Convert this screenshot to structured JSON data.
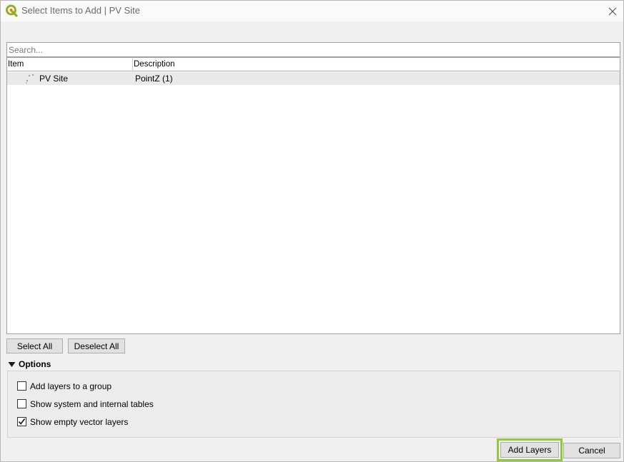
{
  "window": {
    "title": "Select Items to Add | PV Site",
    "app_icon": "qgis-logo-icon",
    "close_icon": "close-icon"
  },
  "search": {
    "placeholder": "Search...",
    "value": ""
  },
  "tree": {
    "columns": [
      "Item",
      "Description"
    ],
    "rows": [
      {
        "item": "PV Site",
        "description": "PointZ (1)",
        "icon": "point-layer-icon",
        "selected": true
      }
    ]
  },
  "selection_buttons": {
    "select_all": "Select All",
    "deselect_all": "Deselect All"
  },
  "options": {
    "label": "Options",
    "expanded": true,
    "checkboxes": [
      {
        "label": "Add layers to a group",
        "checked": false
      },
      {
        "label": "Show system and internal tables",
        "checked": false
      },
      {
        "label": "Show empty vector layers",
        "checked": true
      }
    ]
  },
  "footer": {
    "add_layers": "Add Layers",
    "cancel": "Cancel"
  },
  "colors": {
    "highlight_border": "#93c83e",
    "qgis_green": "#93b023",
    "selected_row": "#e9e9e9"
  }
}
